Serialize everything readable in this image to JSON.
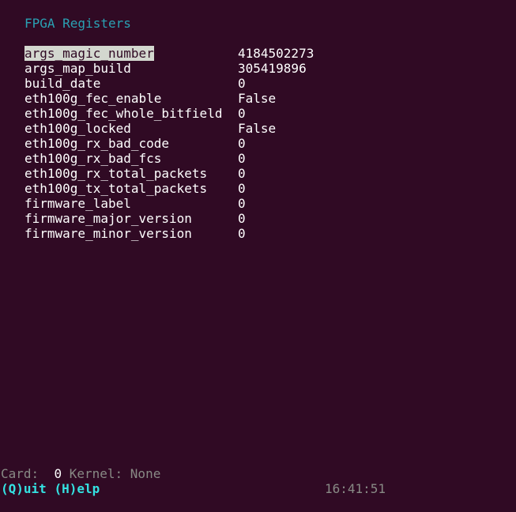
{
  "title": "FPGA Registers",
  "registers": [
    {
      "name": "args_magic_number",
      "value": "4184502273"
    },
    {
      "name": "args_map_build",
      "value": "305419896"
    },
    {
      "name": "build_date",
      "value": "0"
    },
    {
      "name": "eth100g_fec_enable",
      "value": "False"
    },
    {
      "name": "eth100g_fec_whole_bitfield",
      "value": "0"
    },
    {
      "name": "eth100g_locked",
      "value": "False"
    },
    {
      "name": "eth100g_rx_bad_code",
      "value": "0"
    },
    {
      "name": "eth100g_rx_bad_fcs",
      "value": "0"
    },
    {
      "name": "eth100g_rx_total_packets",
      "value": "0"
    },
    {
      "name": "eth100g_tx_total_packets",
      "value": "0"
    },
    {
      "name": "firmware_label",
      "value": "0"
    },
    {
      "name": "firmware_major_version",
      "value": "0"
    },
    {
      "name": "firmware_minor_version",
      "value": "0"
    }
  ],
  "selected_index": 0,
  "status": {
    "card_label": "Card:",
    "card_value": "0",
    "kernel_label": "Kernel:",
    "kernel_value": "None"
  },
  "help": {
    "quit": "(Q)uit",
    "help": "(H)elp"
  },
  "clock": "16:41:51",
  "colors": {
    "background": "#300a24",
    "title": "#2aa1b3",
    "highlight_bg": "#d3d7cf",
    "help": "#34e2e2",
    "muted": "#888a85"
  }
}
